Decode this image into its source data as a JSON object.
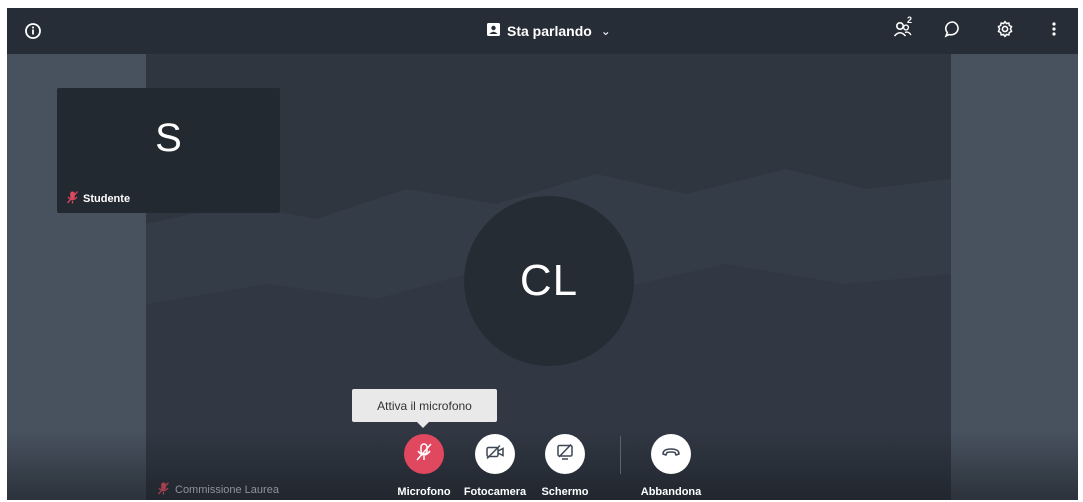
{
  "topbar": {
    "view_label": "Sta parlando",
    "participants_count": "2",
    "icons": {
      "info": "info-icon",
      "view": "speaker-view-icon",
      "chevron": "chevron-down-icon",
      "participants": "participants-icon",
      "chat": "chat-icon",
      "settings": "gear-icon",
      "more": "more-vertical-icon"
    }
  },
  "tile": {
    "initial": "S",
    "name": "Studente",
    "muted_icon": "mic-off-icon"
  },
  "main": {
    "avatar_initials": "CL",
    "speaker_name": "Commissione Laurea"
  },
  "tooltip": {
    "text": "Attiva il microfono"
  },
  "controls": {
    "mic_label": "Microfono",
    "camera_label": "Fotocamera",
    "screen_label": "Schermo",
    "leave_label": "Abbandona"
  },
  "colors": {
    "topbar": "#262d36",
    "mic_active_red": "#e0485f",
    "stage": "#2f3640"
  }
}
